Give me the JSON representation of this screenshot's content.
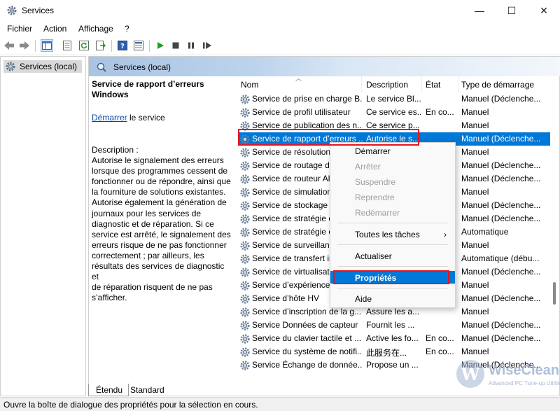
{
  "window": {
    "title": "Services",
    "minimize": "—",
    "maximize": "☐",
    "close": "✕"
  },
  "menu": [
    "Fichier",
    "Action",
    "Affichage",
    "?"
  ],
  "tree": {
    "item": "Services (local)"
  },
  "pane": {
    "header": "Services (local)"
  },
  "description": {
    "title": "Service de rapport d’erreurs Windows",
    "start_link": "Démarrer",
    "start_suffix": " le service",
    "body": "Description :\nAutorise le signalement des erreurs\nlorsque des programmes cessent de\nfonctionner ou de répondre, ainsi que\nla fourniture de solutions existantes.\nAutorise également la génération de\njournaux pour les services de\ndiagnostic et de réparation. Si ce\nservice est arrêté, le signalement des\nerreurs risque de ne pas fonctionner\ncorrectement ; par ailleurs, les\nrésultats des services de diagnostic et\nde réparation risquent de ne pas\ns’afficher."
  },
  "columns": [
    "Nom",
    "Description",
    "État",
    "Type de démarrage"
  ],
  "rows": [
    {
      "name": "Service de prise en charge B...",
      "desc": "Le service Bl...",
      "state": "",
      "startup": "Manuel (Déclenche..."
    },
    {
      "name": "Service de profil utilisateur",
      "desc": "Ce service es...",
      "state": "En co...",
      "startup": "Manuel"
    },
    {
      "name": "Service de publication des n...",
      "desc": "Ce service p...",
      "state": "",
      "startup": "Manuel"
    },
    {
      "name": "Service de rapport d’erreurs ...",
      "desc": "Autorise le s...",
      "state": "",
      "startup": "Manuel (Déclenche..."
    },
    {
      "name": "Service de résolution",
      "desc": "",
      "state": "",
      "startup": "Manuel"
    },
    {
      "name": "Service de routage d",
      "desc": "",
      "state": "",
      "startup": "Manuel (Déclenche..."
    },
    {
      "name": "Service de routeur Al",
      "desc": "",
      "state": "",
      "startup": "Manuel (Déclenche..."
    },
    {
      "name": "Service de simulation",
      "desc": "",
      "state": "",
      "startup": "Manuel"
    },
    {
      "name": "Service de stockage",
      "desc": "",
      "state": "",
      "startup": "Manuel (Déclenche..."
    },
    {
      "name": "Service de stratégie c",
      "desc": "",
      "state": "",
      "startup": "Manuel (Déclenche..."
    },
    {
      "name": "Service de stratégie c",
      "desc": "",
      "state": "",
      "startup": "Automatique"
    },
    {
      "name": "Service de surveillanc",
      "desc": "",
      "state": "",
      "startup": "Manuel"
    },
    {
      "name": "Service de transfert in",
      "desc": "",
      "state": "",
      "startup": "Automatique (débu..."
    },
    {
      "name": "Service de virtualisati",
      "desc": "",
      "state": "",
      "startup": "Manuel (Déclenche..."
    },
    {
      "name": "Service d’expérience",
      "desc": "",
      "state": "",
      "startup": "Manuel"
    },
    {
      "name": "Service d’hôte HV",
      "desc": "",
      "state": "",
      "startup": "Manuel (Déclenche..."
    },
    {
      "name": "Service d’inscription de la g...",
      "desc": "Assure les a...",
      "state": "",
      "startup": "Manuel"
    },
    {
      "name": "Service Données de capteur",
      "desc": "Fournit les ...",
      "state": "",
      "startup": "Manuel (Déclenche..."
    },
    {
      "name": "Service du clavier tactile et ...",
      "desc": "Active les fo...",
      "state": "En co...",
      "startup": "Manuel (Déclenche..."
    },
    {
      "name": "Service du système de notifi...",
      "desc": "此服务在...",
      "state": "En co...",
      "startup": "Manuel"
    },
    {
      "name": "Service Échange de donnée...",
      "desc": "Propose un ...",
      "state": "",
      "startup": "Manuel (Déclenche..."
    }
  ],
  "context_menu": {
    "start": "Démarrer",
    "stop": "Arrêter",
    "pause": "Suspendre",
    "resume": "Reprendre",
    "restart": "Redémarrer",
    "all_tasks": "Toutes les tâches",
    "submenu_arrow": "›",
    "refresh": "Actualiser",
    "properties": "Propriétés",
    "help": "Aide"
  },
  "tabs": [
    "Étendu",
    "Standard"
  ],
  "status": "Ouvre la boîte de dialogue des propriétés pour la sélection en cours.",
  "watermark": {
    "letter": "W",
    "name": "WiseCleaner",
    "tagline": "Advanced PC Tune-up Utilities"
  },
  "colors": {
    "selection": "#0078d7",
    "highlight_box": "#e8131e",
    "link": "#0645ad"
  }
}
